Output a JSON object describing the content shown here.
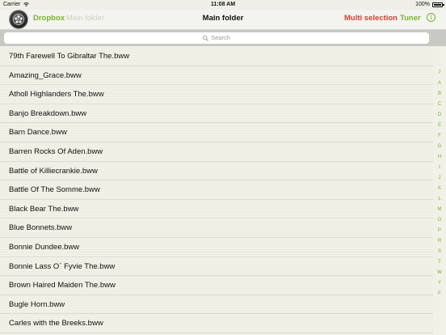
{
  "status_bar": {
    "carrier": "Carrier",
    "time": "11:08 AM",
    "battery": "100%"
  },
  "nav": {
    "dropbox": "Dropbox",
    "crumb": "Main folder",
    "title": "Main folder",
    "multi_selection": "Multi selection",
    "tuner": "Tuner",
    "info": "i"
  },
  "search": {
    "placeholder": "Search"
  },
  "files": [
    "79th Farewell To Gibraltar The.bww",
    "Amazing_Grace.bww",
    "Atholl Highlanders The.bww",
    "Banjo Breakdown.bww",
    "Barn Dance.bww",
    "Barren Rocks Of Aden.bww",
    "Battle of Killiecrankie.bww",
    "Battle Of The Somme.bww",
    "Black Bear The.bww",
    "Blue Bonnets.bww",
    "Bonnie Dundee.bww",
    "Bonnie Lass O` Fyvie The.bww",
    "Brown Haired Maiden The.bww",
    "Bugle Horn.bww",
    "Carles with the Breeks.bww"
  ],
  "index_letters": [
    "7",
    "A",
    "B",
    "C",
    "D",
    "E",
    "F",
    "G",
    "H",
    "I",
    "J",
    "K",
    "L",
    "M",
    "O",
    "P",
    "R",
    "S",
    "T",
    "W",
    "Y",
    "F"
  ],
  "colors": {
    "accent_green": "#7ab32e",
    "accent_red": "#d13f2f"
  }
}
